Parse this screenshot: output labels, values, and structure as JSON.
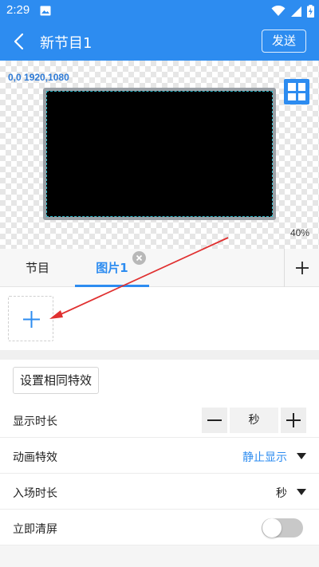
{
  "status_bar": {
    "time": "2:29",
    "icons": [
      "image-icon",
      "wifi-icon",
      "signal-icon",
      "battery-charging-icon"
    ]
  },
  "header": {
    "title": "新节目1",
    "send_label": "发送",
    "back_icon": "back-arrow-icon"
  },
  "preview": {
    "coordinates": "0,0 1920,1080",
    "zoom": "40%",
    "layout_icon": "grid-layout-icon"
  },
  "tabs": [
    {
      "label": "节目",
      "active": false
    },
    {
      "label": "图片1",
      "active": true,
      "closable": true
    }
  ],
  "tab_add_icon": "plus-icon",
  "add_image_icon": "plus-icon",
  "settings": {
    "same_effect_label": "设置相同特效",
    "display_duration": {
      "label": "显示时长",
      "unit": "秒"
    },
    "animation_effect": {
      "label": "动画特效",
      "value": "静止显示"
    },
    "entrance_duration": {
      "label": "入场时长",
      "unit": "秒"
    },
    "clear_screen": {
      "label": "立即清屏",
      "enabled": false
    }
  },
  "colors": {
    "primary": "#2d8cf0",
    "coordinates_text": "#2d7ad6",
    "annotation_arrow": "#e03030",
    "screen_border": "#29b6c6"
  }
}
